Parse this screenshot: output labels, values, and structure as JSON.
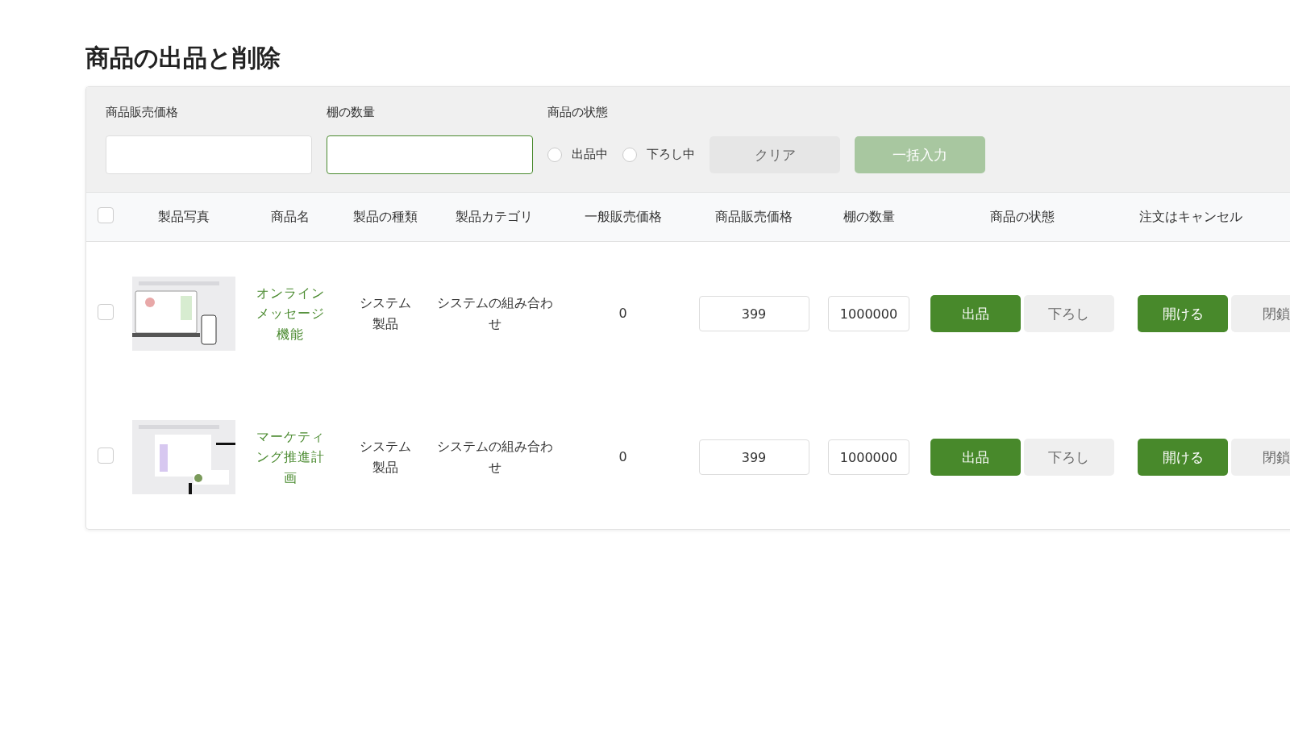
{
  "title": "商品の出品と削除",
  "filters": {
    "fields": [
      {
        "label": "商品販売価格",
        "focused": false
      },
      {
        "label": "棚の数量",
        "focused": true
      }
    ],
    "status": {
      "label": "商品の状態",
      "options": [
        {
          "label": "出品中",
          "selected": false
        },
        {
          "label": "下ろし中",
          "selected": false
        }
      ]
    },
    "buttons": [
      {
        "label": "クリア",
        "kind": "clear",
        "disabled": false
      },
      {
        "label": "一括入力",
        "kind": "primary",
        "disabled": true
      }
    ]
  },
  "table": {
    "all_selected": false,
    "columns": [
      "製品写真",
      "商品名",
      "製品の種類",
      "製品カテゴリ",
      "一般販売価格",
      "商品販売価格",
      "棚の数量",
      "商品の状態",
      "注文はキャンセル"
    ],
    "rows": [
      {
        "selected": false,
        "name": "オンラインメッセージ機能",
        "type": "システム製品",
        "category": "システムの組み合わせ",
        "general_price": "0",
        "sell_price": "399",
        "shelf_qty": "1000000",
        "status_buttons": [
          {
            "label": "出品",
            "selected": true
          },
          {
            "label": "下ろし",
            "selected": false
          }
        ],
        "cancel_buttons": [
          {
            "label": "開ける",
            "selected": true
          },
          {
            "label": "閉鎖",
            "selected": false
          }
        ]
      },
      {
        "selected": false,
        "name": "マーケティング推進計画",
        "type": "システム製品",
        "category": "システムの組み合わせ",
        "general_price": "0",
        "sell_price": "399",
        "shelf_qty": "1000000",
        "status_buttons": [
          {
            "label": "出品",
            "selected": true
          },
          {
            "label": "下ろし",
            "selected": false
          }
        ],
        "cancel_buttons": [
          {
            "label": "開ける",
            "selected": true
          },
          {
            "label": "閉鎖",
            "selected": false
          }
        ]
      }
    ]
  }
}
